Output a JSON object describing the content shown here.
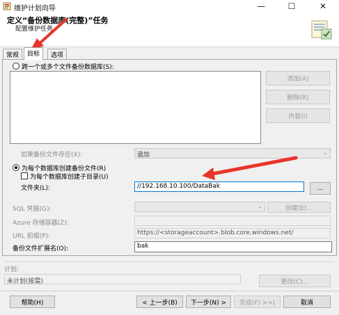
{
  "window": {
    "title": "维护计划向导",
    "minimize_glyph": "—",
    "maximize_glyph": "☐",
    "close_glyph": "✕"
  },
  "header": {
    "title": "定义“备份数据库(完整)”任务",
    "subtitle": "配置维护任务。"
  },
  "tabs": [
    {
      "label": "常规",
      "active": false
    },
    {
      "label": "目标",
      "active": true
    },
    {
      "label": "选项",
      "active": false
    }
  ],
  "destination": {
    "across_files_label": "跨一个或多个文件备份数据库(S):",
    "add_button": "添加(A)",
    "remove_button": "删除(R)",
    "contents_button": "内容(I)",
    "if_exists_label": "如果备份文件存在(X):",
    "if_exists_value": "追加",
    "per_db_label": "为每个数据库创建备份文件(R)",
    "subdir_label": "为每个数据库创建子目录(U)",
    "folder_label": "文件夹(L):",
    "folder_value": "//192.168.10.100/DataBak",
    "browse_button": "...",
    "sql_credential_label": "SQL 凭据(G):",
    "create_button": "创建(E)...",
    "azure_container_label": "Azure 存储容器(Z):",
    "url_prefix_label": "URL 前缀(P):",
    "url_prefix_value": "https://<storageaccount>.blob.core.windows.net/",
    "extension_label": "备份文件扩展名(O):",
    "extension_value": "bak"
  },
  "schedule": {
    "label": "计划:",
    "value": "未计划(按需)",
    "change_button": "更改(C)..."
  },
  "footer": {
    "help_button": "帮助(H)",
    "back_button": "< 上一步(B)",
    "next_button": "下一步(N) >",
    "finish_button": "完成(F) >>|",
    "cancel_button": "取消"
  },
  "colors": {
    "annotation_arrow": "#e8352a",
    "focus_border": "#0078d7"
  }
}
